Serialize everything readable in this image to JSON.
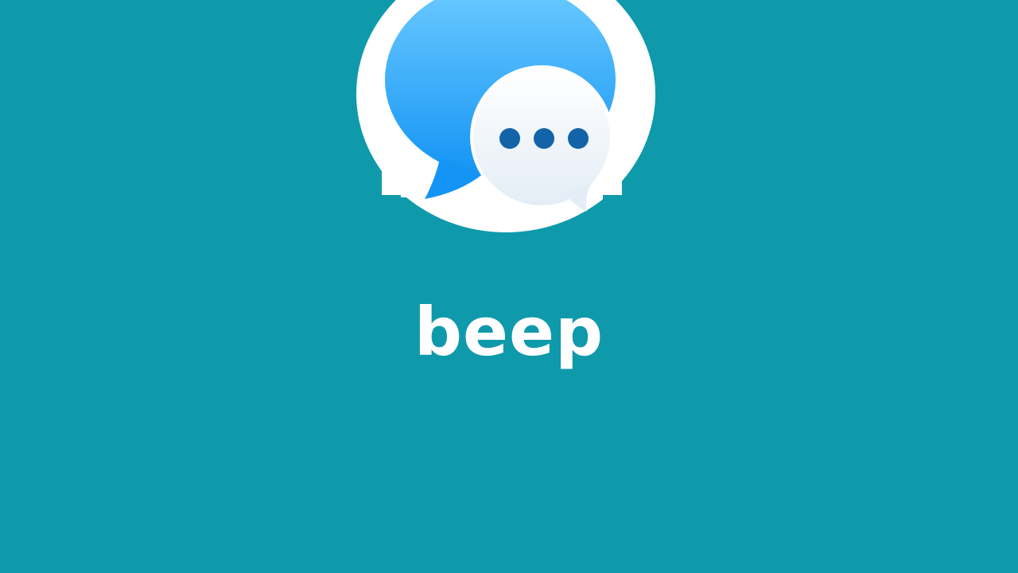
{
  "app": {
    "name": "beep"
  },
  "logo": {
    "icon": "chat-bubbles-icon"
  },
  "colors": {
    "background": "#0f9aab",
    "bubble_blue_top": "#6ccbff",
    "bubble_blue_bottom": "#1494f5",
    "bubble_white_top": "#ffffff",
    "bubble_white_bottom": "#e4edf6",
    "dots": "#1363a8",
    "text": "#ffffff"
  }
}
